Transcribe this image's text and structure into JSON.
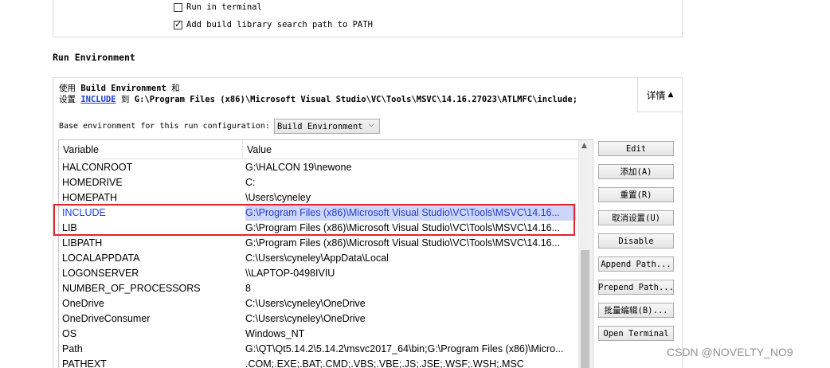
{
  "top_options": {
    "run_in_terminal": {
      "label": "Run in terminal",
      "checked": false
    },
    "add_library_path": {
      "label": "Add build library search path to PATH",
      "checked": true
    }
  },
  "section_title": "Run Environment",
  "summary": {
    "line1_prefix": "使用",
    "line1_env": "Build Environment",
    "line1_suffix": "和",
    "line2_prefix": "设置",
    "line2_var": "INCLUDE",
    "line2_to": "到",
    "line2_value": "G:\\Program Files (x86)\\Microsoft Visual Studio\\VC\\Tools\\MSVC\\14.16.27023\\ATLMFC\\include;"
  },
  "details_button": {
    "label": "详情",
    "icon": "triangle-up-icon"
  },
  "base_env": {
    "label": "Base environment for this run configuration:",
    "selected": "Build Environment"
  },
  "table": {
    "headers": {
      "variable": "Variable",
      "value": "Value"
    },
    "rows": [
      {
        "variable": "HALCONROOT",
        "value": "G:\\HALCON 19\\newone",
        "modified": false
      },
      {
        "variable": "HOMEDRIVE",
        "value": "C:",
        "modified": false
      },
      {
        "variable": "HOMEPATH",
        "value": "\\Users\\cyneley",
        "modified": false
      },
      {
        "variable": "INCLUDE",
        "value": "G:\\Program Files (x86)\\Microsoft Visual Studio\\VC\\Tools\\MSVC\\14.16...",
        "modified": true
      },
      {
        "variable": "LIB",
        "value": "G:\\Program Files (x86)\\Microsoft Visual Studio\\VC\\Tools\\MSVC\\14.16...",
        "modified": false
      },
      {
        "variable": "LIBPATH",
        "value": "G:\\Program Files (x86)\\Microsoft Visual Studio\\VC\\Tools\\MSVC\\14.16...",
        "modified": false
      },
      {
        "variable": "LOCALAPPDATA",
        "value": "C:\\Users\\cyneley\\AppData\\Local",
        "modified": false
      },
      {
        "variable": "LOGONSERVER",
        "value": "\\\\LAPTOP-0498IVIU",
        "modified": false
      },
      {
        "variable": "NUMBER_OF_PROCESSORS",
        "value": "8",
        "modified": false
      },
      {
        "variable": "OneDrive",
        "value": "C:\\Users\\cyneley\\OneDrive",
        "modified": false
      },
      {
        "variable": "OneDriveConsumer",
        "value": "C:\\Users\\cyneley\\OneDrive",
        "modified": false
      },
      {
        "variable": "OS",
        "value": "Windows_NT",
        "modified": false
      },
      {
        "variable": "Path",
        "value": "G:\\QT\\Qt5.14.2\\5.14.2\\msvc2017_64\\bin;G:\\Program Files (x86)\\Micro...",
        "modified": false
      },
      {
        "variable": "PATHEXT",
        "value": ".COM;.EXE;.BAT;.CMD;.VBS;.VBE;.JS;.JSE;.WSF;.WSH;.MSC",
        "modified": false
      }
    ]
  },
  "buttons": {
    "edit": "Edit",
    "add": "添加(A)",
    "reset": "重置(R)",
    "unset": "取消设置(U)",
    "disable": "Disable",
    "append_path": "Append Path...",
    "prepend_path": "Prepend Path...",
    "batch_edit": "批量编辑(B)...",
    "open_terminal": "Open Terminal"
  },
  "watermark": "CSDN @NOVELTY_NO9",
  "colors": {
    "modified_text": "#1f3fd2",
    "modified_bg": "#cdd6f9",
    "annotation_border": "#e0262b",
    "link": "#1a3fd6"
  }
}
